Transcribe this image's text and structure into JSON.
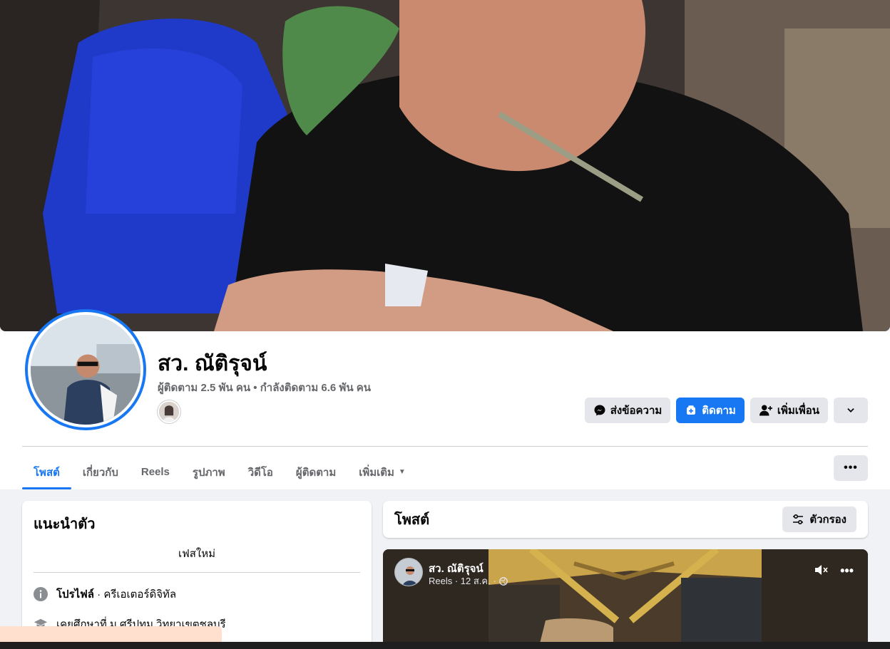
{
  "profile": {
    "name": "สว. ณัติรุจน์",
    "stats": "ผู้ติดตาม 2.5 พัน คน • กำลังติดตาม 6.6 พัน คน"
  },
  "actions": {
    "message": "ส่งข้อความ",
    "follow": "ติดตาม",
    "add_friend": "เพิ่มเพื่อน"
  },
  "tabs": [
    {
      "label": "โพสต์"
    },
    {
      "label": "เกี่ยวกับ"
    },
    {
      "label": "Reels"
    },
    {
      "label": "รูปภาพ"
    },
    {
      "label": "วิดีโอ"
    },
    {
      "label": "ผู้ติดตาม"
    },
    {
      "label": "เพิ่มเติม"
    }
  ],
  "intro": {
    "title": "แนะนำตัว",
    "bio": "เฟสใหม่",
    "profile_label": "โปรไฟล์",
    "profile_value": " · ครีเอเตอร์ดิจิทัล",
    "education": "เคยศึกษาที่ ม.ศรีปทุม วิทยาเขตชลบุรี"
  },
  "posts": {
    "title": "โพสต์",
    "filter": "ตัวกรอง"
  },
  "reel": {
    "author": "สว. ณัติรุจน์",
    "meta": "Reels · 12 ส.ค. ·"
  },
  "colors": {
    "accent": "#1877f2",
    "secondary_text": "#65676b",
    "button_gray": "#e4e6eb"
  }
}
